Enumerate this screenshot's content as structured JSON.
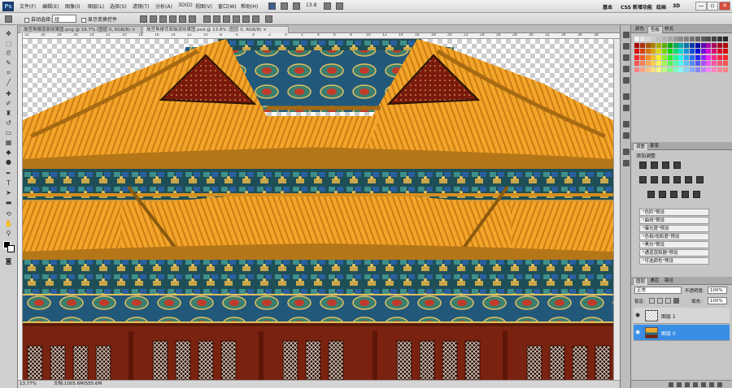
{
  "app": {
    "logo": "Ps"
  },
  "menu": [
    "文件(F)",
    "编辑(E)",
    "图像(I)",
    "图层(L)",
    "选择(S)",
    "滤镜(T)",
    "分析(A)",
    "3D(D)",
    "视图(V)",
    "窗口(W)",
    "帮助(H)"
  ],
  "menu_right": {
    "zoom": "13.8",
    "workspaces": [
      "基本",
      "CSS 新增功能",
      "绘画",
      "3D"
    ]
  },
  "window_controls": {
    "minimize": "—",
    "restore": "▫",
    "close": "✕"
  },
  "options": {
    "auto_select_label": "自动选择:",
    "auto_select_value": "组",
    "show_transform_label": "显示变换控件"
  },
  "tabs": [
    {
      "label": "故宫角楼南侧效果图.png @ 16.7% (图层 0, RGB/8) ×",
      "active": false
    },
    {
      "label": "故宫角楼背面轴测效果图.psd @ 13.8% (图层 0, RGB/8) ×",
      "active": true
    }
  ],
  "ruler": [
    "32",
    "30",
    "28",
    "26",
    "24",
    "22",
    "20",
    "18",
    "16",
    "14",
    "12",
    "10",
    "8",
    "6",
    "4",
    "2",
    "0",
    "2",
    "4",
    "6",
    "8",
    "10",
    "12",
    "14",
    "16",
    "18",
    "20",
    "22",
    "24",
    "26",
    "28",
    "30",
    "32",
    "34",
    "36",
    "38"
  ],
  "status": {
    "zoom": "13.77%",
    "doc": "文档:1005.6M/555.6M"
  },
  "color_panel": {
    "tabs": [
      "颜色",
      "色板",
      "样式"
    ],
    "active": "色板"
  },
  "adjust_panel": {
    "tabs": [
      "调整",
      "蒙版"
    ],
    "title": "添加调整",
    "presets": [
      "\"色阶\"预设",
      "\"曲线\"预设",
      "\"曝光度\"预设",
      "\"色相/饱和度\"预设",
      "\"黑白\"预设",
      "\"通道混和器\"预设",
      "\"可选颜色\"预设"
    ]
  },
  "layers_panel": {
    "tabs": [
      "图层",
      "通道",
      "路径"
    ],
    "blend_mode": "正常",
    "opacity_label": "不透明度:",
    "opacity_value": "100%",
    "lock_label": "锁定:",
    "fill_label": "填充:",
    "fill_value": "100%",
    "layers": [
      {
        "name": "图层 1",
        "selected": false
      },
      {
        "name": "图层 0",
        "selected": true
      }
    ]
  },
  "colors": {
    "accent": "#3a8ee6",
    "roof": "#f0a830",
    "wall": "#7a2210",
    "beam": "#2f6f78"
  }
}
